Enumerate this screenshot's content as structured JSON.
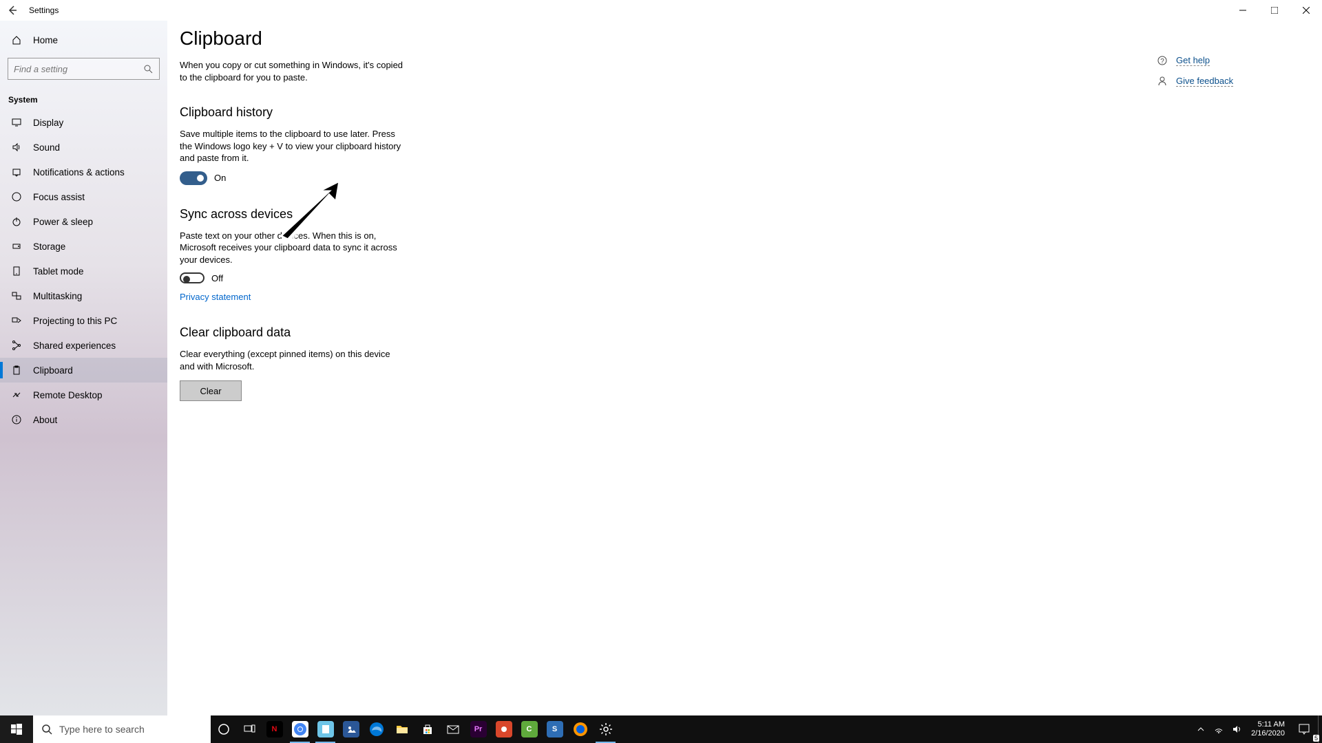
{
  "titlebar": {
    "title": "Settings"
  },
  "sidebar": {
    "home": "Home",
    "search_placeholder": "Find a setting",
    "section": "System",
    "items": [
      {
        "label": "Display"
      },
      {
        "label": "Sound"
      },
      {
        "label": "Notifications & actions"
      },
      {
        "label": "Focus assist"
      },
      {
        "label": "Power & sleep"
      },
      {
        "label": "Storage"
      },
      {
        "label": "Tablet mode"
      },
      {
        "label": "Multitasking"
      },
      {
        "label": "Projecting to this PC"
      },
      {
        "label": "Shared experiences"
      },
      {
        "label": "Clipboard"
      },
      {
        "label": "Remote Desktop"
      },
      {
        "label": "About"
      }
    ],
    "active_index": 10
  },
  "page": {
    "title": "Clipboard",
    "intro": "When you copy or cut something in Windows, it's copied to the clipboard for you to paste.",
    "sections": {
      "history": {
        "heading": "Clipboard history",
        "desc": "Save multiple items to the clipboard to use later. Press the Windows logo key + V to view your clipboard history and paste from it.",
        "toggle_state": "On"
      },
      "sync": {
        "heading": "Sync across devices",
        "desc": "Paste text on your other devices. When this is on, Microsoft receives your clipboard data to sync it across your devices.",
        "toggle_state": "Off",
        "privacy_link": "Privacy statement"
      },
      "clear": {
        "heading": "Clear clipboard data",
        "desc": "Clear everything (except pinned items) on this device and with Microsoft.",
        "button": "Clear"
      }
    }
  },
  "help": {
    "get_help": "Get help",
    "give_feedback": "Give feedback"
  },
  "taskbar": {
    "search_placeholder": "Type here to search",
    "apps": [
      {
        "name": "cortana"
      },
      {
        "name": "task-view"
      },
      {
        "name": "netflix"
      },
      {
        "name": "chrome"
      },
      {
        "name": "notepad"
      },
      {
        "name": "photos"
      },
      {
        "name": "edge"
      },
      {
        "name": "file-explorer"
      },
      {
        "name": "microsoft-store"
      },
      {
        "name": "mail"
      },
      {
        "name": "premiere"
      },
      {
        "name": "camtasia-rec"
      },
      {
        "name": "camtasia"
      },
      {
        "name": "snagit"
      },
      {
        "name": "firefox"
      },
      {
        "name": "settings"
      }
    ],
    "running": [
      "chrome",
      "notepad",
      "settings"
    ]
  },
  "tray": {
    "time": "5:11 AM",
    "date": "2/16/2020",
    "notif_count": "5"
  }
}
